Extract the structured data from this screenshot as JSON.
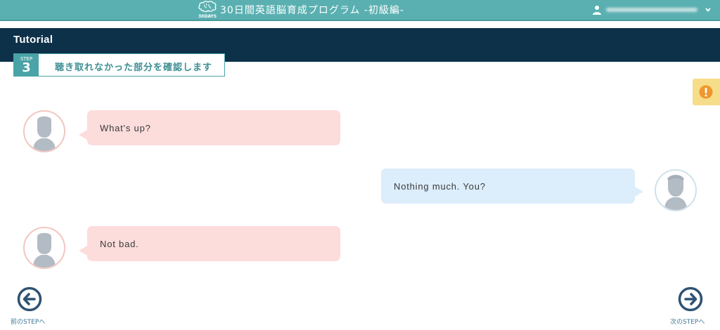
{
  "topbar": {
    "logo_text": "30DAYS",
    "title": "30日間英語脳育成プログラム -初級編-"
  },
  "header": {
    "title": "Tutorial"
  },
  "step": {
    "word": "STEP",
    "number": "3",
    "text": "聴き取れなかった部分を確認します"
  },
  "chat": {
    "messages": [
      {
        "speaker": "left",
        "text": "What's up?"
      },
      {
        "speaker": "right",
        "text": "Nothing much. You?"
      },
      {
        "speaker": "left",
        "text": "Not bad."
      }
    ]
  },
  "nav": {
    "prev_label": "前のSTEPへ",
    "next_label": "次のSTEPへ"
  },
  "colors": {
    "topbar": "#5ab0b1",
    "header_band": "#0d3149",
    "accent_teal": "#4aa3a6",
    "bubble_left": "#fddcdc",
    "bubble_right": "#dcedfb",
    "nav_icon": "#2f5373",
    "alert_bg": "#f6dd8a",
    "alert_icon": "#f0962c"
  },
  "icons": [
    "brain-logo-icon",
    "user-icon",
    "chevron-down-icon",
    "alert-icon",
    "arrow-left-circle-icon",
    "arrow-right-circle-icon",
    "avatar-silhouette-icon"
  ]
}
